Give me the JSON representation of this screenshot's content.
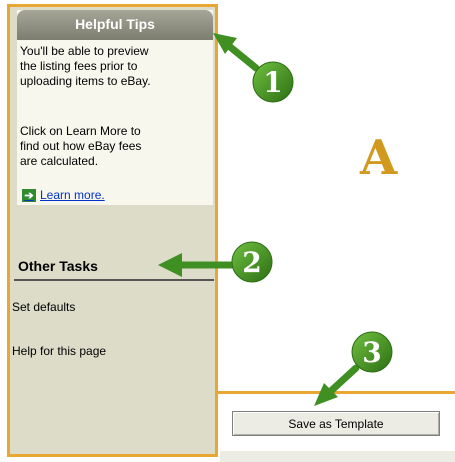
{
  "helpful_tips": {
    "title": "Helpful Tips",
    "para1_lines": [
      "You'll be able to preview",
      "the listing fees prior to",
      "uploading items to eBay."
    ],
    "para2_lines": [
      "Click on Learn More to",
      "find out how eBay fees",
      "are calculated."
    ],
    "learn_more": "Learn more."
  },
  "other_tasks": {
    "title": "Other Tasks",
    "items": [
      "Set defaults",
      "Help for this page"
    ]
  },
  "main": {
    "letter": "A",
    "save_template_label": "Save as Template"
  },
  "callouts": {
    "one": "1",
    "two": "2",
    "three": "3"
  },
  "colors": {
    "accent_orange": "#e8a733",
    "callout_green": "#3f8f22",
    "letter_gold": "#d19a1e"
  },
  "icons": {
    "learn_more": "green-arrow-icon"
  }
}
